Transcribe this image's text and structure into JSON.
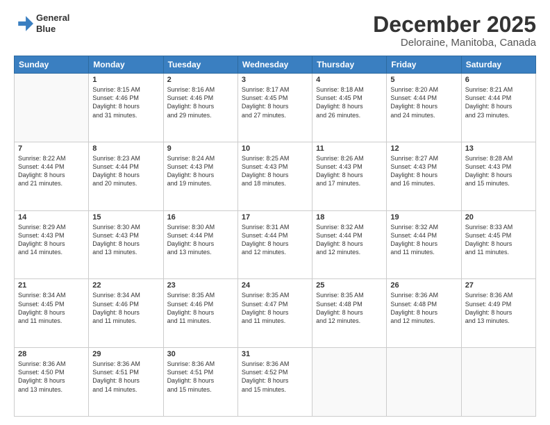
{
  "header": {
    "logo_line1": "General",
    "logo_line2": "Blue",
    "month": "December 2025",
    "location": "Deloraine, Manitoba, Canada"
  },
  "days_of_week": [
    "Sunday",
    "Monday",
    "Tuesday",
    "Wednesday",
    "Thursday",
    "Friday",
    "Saturday"
  ],
  "weeks": [
    [
      {
        "day": "",
        "info": ""
      },
      {
        "day": "1",
        "info": "Sunrise: 8:15 AM\nSunset: 4:46 PM\nDaylight: 8 hours\nand 31 minutes."
      },
      {
        "day": "2",
        "info": "Sunrise: 8:16 AM\nSunset: 4:46 PM\nDaylight: 8 hours\nand 29 minutes."
      },
      {
        "day": "3",
        "info": "Sunrise: 8:17 AM\nSunset: 4:45 PM\nDaylight: 8 hours\nand 27 minutes."
      },
      {
        "day": "4",
        "info": "Sunrise: 8:18 AM\nSunset: 4:45 PM\nDaylight: 8 hours\nand 26 minutes."
      },
      {
        "day": "5",
        "info": "Sunrise: 8:20 AM\nSunset: 4:44 PM\nDaylight: 8 hours\nand 24 minutes."
      },
      {
        "day": "6",
        "info": "Sunrise: 8:21 AM\nSunset: 4:44 PM\nDaylight: 8 hours\nand 23 minutes."
      }
    ],
    [
      {
        "day": "7",
        "info": "Sunrise: 8:22 AM\nSunset: 4:44 PM\nDaylight: 8 hours\nand 21 minutes."
      },
      {
        "day": "8",
        "info": "Sunrise: 8:23 AM\nSunset: 4:44 PM\nDaylight: 8 hours\nand 20 minutes."
      },
      {
        "day": "9",
        "info": "Sunrise: 8:24 AM\nSunset: 4:43 PM\nDaylight: 8 hours\nand 19 minutes."
      },
      {
        "day": "10",
        "info": "Sunrise: 8:25 AM\nSunset: 4:43 PM\nDaylight: 8 hours\nand 18 minutes."
      },
      {
        "day": "11",
        "info": "Sunrise: 8:26 AM\nSunset: 4:43 PM\nDaylight: 8 hours\nand 17 minutes."
      },
      {
        "day": "12",
        "info": "Sunrise: 8:27 AM\nSunset: 4:43 PM\nDaylight: 8 hours\nand 16 minutes."
      },
      {
        "day": "13",
        "info": "Sunrise: 8:28 AM\nSunset: 4:43 PM\nDaylight: 8 hours\nand 15 minutes."
      }
    ],
    [
      {
        "day": "14",
        "info": "Sunrise: 8:29 AM\nSunset: 4:43 PM\nDaylight: 8 hours\nand 14 minutes."
      },
      {
        "day": "15",
        "info": "Sunrise: 8:30 AM\nSunset: 4:43 PM\nDaylight: 8 hours\nand 13 minutes."
      },
      {
        "day": "16",
        "info": "Sunrise: 8:30 AM\nSunset: 4:44 PM\nDaylight: 8 hours\nand 13 minutes."
      },
      {
        "day": "17",
        "info": "Sunrise: 8:31 AM\nSunset: 4:44 PM\nDaylight: 8 hours\nand 12 minutes."
      },
      {
        "day": "18",
        "info": "Sunrise: 8:32 AM\nSunset: 4:44 PM\nDaylight: 8 hours\nand 12 minutes."
      },
      {
        "day": "19",
        "info": "Sunrise: 8:32 AM\nSunset: 4:44 PM\nDaylight: 8 hours\nand 11 minutes."
      },
      {
        "day": "20",
        "info": "Sunrise: 8:33 AM\nSunset: 4:45 PM\nDaylight: 8 hours\nand 11 minutes."
      }
    ],
    [
      {
        "day": "21",
        "info": "Sunrise: 8:34 AM\nSunset: 4:45 PM\nDaylight: 8 hours\nand 11 minutes."
      },
      {
        "day": "22",
        "info": "Sunrise: 8:34 AM\nSunset: 4:46 PM\nDaylight: 8 hours\nand 11 minutes."
      },
      {
        "day": "23",
        "info": "Sunrise: 8:35 AM\nSunset: 4:46 PM\nDaylight: 8 hours\nand 11 minutes."
      },
      {
        "day": "24",
        "info": "Sunrise: 8:35 AM\nSunset: 4:47 PM\nDaylight: 8 hours\nand 11 minutes."
      },
      {
        "day": "25",
        "info": "Sunrise: 8:35 AM\nSunset: 4:48 PM\nDaylight: 8 hours\nand 12 minutes."
      },
      {
        "day": "26",
        "info": "Sunrise: 8:36 AM\nSunset: 4:48 PM\nDaylight: 8 hours\nand 12 minutes."
      },
      {
        "day": "27",
        "info": "Sunrise: 8:36 AM\nSunset: 4:49 PM\nDaylight: 8 hours\nand 13 minutes."
      }
    ],
    [
      {
        "day": "28",
        "info": "Sunrise: 8:36 AM\nSunset: 4:50 PM\nDaylight: 8 hours\nand 13 minutes."
      },
      {
        "day": "29",
        "info": "Sunrise: 8:36 AM\nSunset: 4:51 PM\nDaylight: 8 hours\nand 14 minutes."
      },
      {
        "day": "30",
        "info": "Sunrise: 8:36 AM\nSunset: 4:51 PM\nDaylight: 8 hours\nand 15 minutes."
      },
      {
        "day": "31",
        "info": "Sunrise: 8:36 AM\nSunset: 4:52 PM\nDaylight: 8 hours\nand 15 minutes."
      },
      {
        "day": "",
        "info": ""
      },
      {
        "day": "",
        "info": ""
      },
      {
        "day": "",
        "info": ""
      }
    ]
  ]
}
